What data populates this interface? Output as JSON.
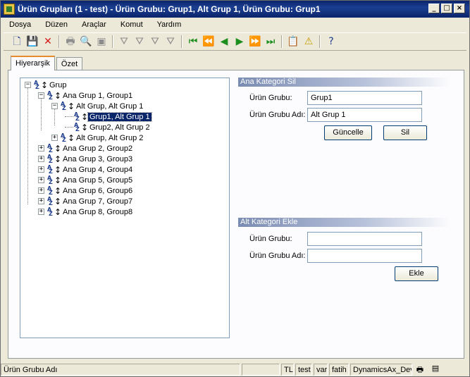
{
  "window": {
    "title": "Ürün Grupları (1 - test) - Ürün Grubu: Grup1, Alt Grup 1, Ürün Grubu: Grup1",
    "controls": [
      "_",
      "□",
      "×"
    ]
  },
  "menu": [
    "Dosya",
    "Düzen",
    "Araçlar",
    "Komut",
    "Yardım"
  ],
  "toolbar": {
    "icons": [
      {
        "name": "new-icon",
        "glyph": "🗋",
        "color": "dark"
      },
      {
        "name": "save-icon",
        "glyph": "💾",
        "color": "dark"
      },
      {
        "name": "delete-icon",
        "glyph": "✕",
        "color": "red"
      },
      {
        "name": "print-icon",
        "glyph": "🖶",
        "color": "grey"
      },
      {
        "name": "print-preview-icon",
        "glyph": "🔍",
        "color": "grey"
      },
      {
        "name": "export-icon",
        "glyph": "▣",
        "color": "grey"
      },
      {
        "name": "filter-icon",
        "glyph": "⛛",
        "color": "grey"
      },
      {
        "name": "filter-by-selection-icon",
        "glyph": "⛛",
        "color": "grey"
      },
      {
        "name": "advanced-filter-icon",
        "glyph": "⛛",
        "color": "grey"
      },
      {
        "name": "remove-filter-icon",
        "glyph": "⛛",
        "color": "grey"
      },
      {
        "name": "first-record-icon",
        "glyph": "⏮",
        "color": "green"
      },
      {
        "name": "previous-page-icon",
        "glyph": "⏪",
        "color": "green"
      },
      {
        "name": "previous-record-icon",
        "glyph": "◀",
        "color": "green"
      },
      {
        "name": "next-record-icon",
        "glyph": "▶",
        "color": "green"
      },
      {
        "name": "next-page-icon",
        "glyph": "⏩",
        "color": "green"
      },
      {
        "name": "last-record-icon",
        "glyph": "⏭",
        "color": "green"
      },
      {
        "name": "document-handling-icon",
        "glyph": "📋",
        "color": "grey"
      },
      {
        "name": "alert-icon",
        "glyph": "⚠",
        "color": "yellow"
      },
      {
        "name": "help-icon",
        "glyph": "?",
        "color": "dark"
      }
    ]
  },
  "tabs": [
    "Hiyerarşik",
    "Özet"
  ],
  "tree": {
    "root": "Grup",
    "nodes": [
      {
        "label": "Ana Grup 1, Group1",
        "expander": "−"
      },
      {
        "label": "Alt Grup, Alt Grup 1",
        "expander": "−"
      },
      {
        "label": "Grup1, Alt Grup 1",
        "expander": ""
      },
      {
        "label": "Grup2, Alt Grup 2",
        "expander": ""
      },
      {
        "label": "Alt Grup, Alt Grup 2",
        "expander": "+"
      },
      {
        "label": "Ana Grup 2, Group2",
        "expander": "+"
      },
      {
        "label": "Ana Grup 3, Group3",
        "expander": "+"
      },
      {
        "label": "Ana Grup 4, Group4",
        "expander": "+"
      },
      {
        "label": "Ana Grup 5, Group5",
        "expander": "+"
      },
      {
        "label": "Ana Grup 6, Group6",
        "expander": "+"
      },
      {
        "label": "Ana Grup 7, Group7",
        "expander": "+"
      },
      {
        "label": "Ana Grup 8, Group8",
        "expander": "+"
      }
    ]
  },
  "ana_kategori": {
    "title": "Ana Kategori Sil",
    "group_label": "Ürün Grubu:",
    "group_value": "Grup1",
    "name_label": "Ürün Grubu Adı:",
    "name_value": "Alt Grup 1",
    "update_button": "Güncelle",
    "delete_button": "Sil"
  },
  "alt_kategori": {
    "title": "Alt Kategori Ekle",
    "group_label": "Ürün Grubu:",
    "group_value": "",
    "name_label": "Ürün Grubu Adı:",
    "name_value": "",
    "add_button": "Ekle"
  },
  "status": {
    "field": "Ürün Grubu Adı",
    "currency": "TL",
    "company": "test",
    "flag": "var",
    "user": "fatih",
    "server": "DynamicsAx_Dev"
  }
}
